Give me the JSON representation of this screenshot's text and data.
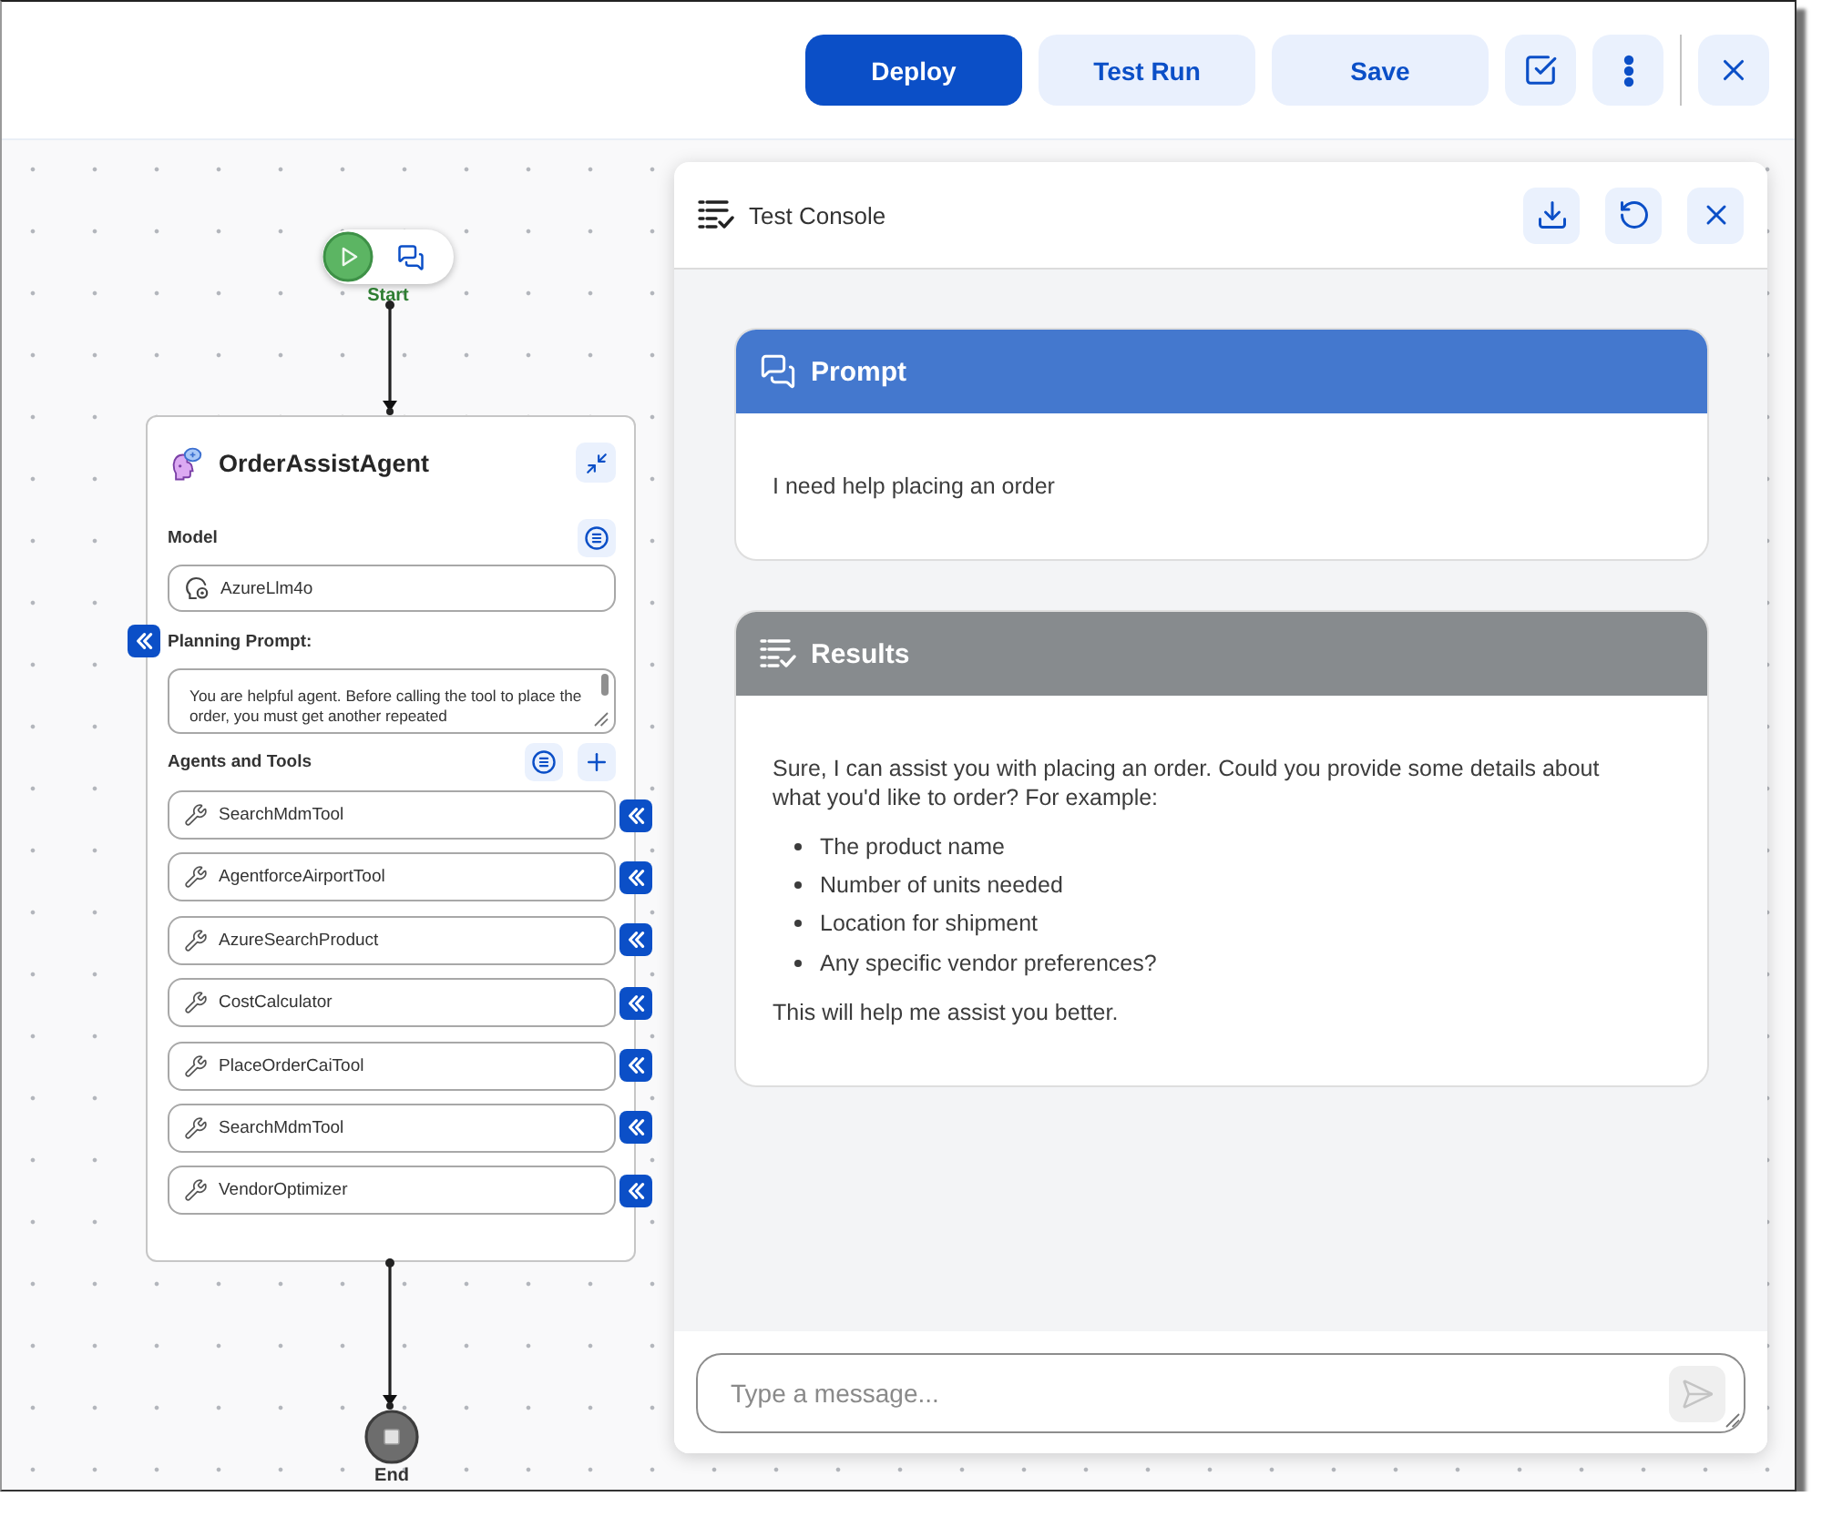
{
  "toolbar": {
    "buttons": [
      {
        "label": "Deploy",
        "kind": "primary"
      },
      {
        "label": "Test Run",
        "kind": "secondary"
      },
      {
        "label": "Save",
        "kind": "secondary"
      }
    ]
  },
  "canvas": {
    "start_node": {
      "label": "Start"
    },
    "agent_node": {
      "title": "OrderAssistAgent",
      "model": {
        "label": "Model",
        "value": "AzureLlm4o"
      },
      "planning_prompt": {
        "label": "Planning Prompt:",
        "value": "You are helpful agent. Before calling the tool to place the order, you must get another repeated"
      },
      "tools": {
        "label": "Agents and Tools",
        "items": [
          "SearchMdmTool",
          "AgentforceAirportTool",
          "AzureSearchProduct",
          "CostCalculator",
          "PlaceOrderCaiTool",
          "SearchMdmTool",
          "VendorOptimizer"
        ]
      }
    },
    "end_node": {
      "label": "End"
    }
  },
  "test_console": {
    "title": "Test Console",
    "prompt": {
      "title": "Prompt",
      "text": "I need help placing an order"
    },
    "results": {
      "title": "Results",
      "intro": "Sure, I can assist you with placing an order. Could you provide some details about what you'd like to order? For example:",
      "items": [
        "The product name",
        "Number of units needed",
        "Location for shipment",
        "Any specific vendor preferences?"
      ],
      "outro": "This will help me assist you better."
    },
    "message_input": {
      "placeholder": "Type a message...",
      "send_disabled": true
    }
  }
}
